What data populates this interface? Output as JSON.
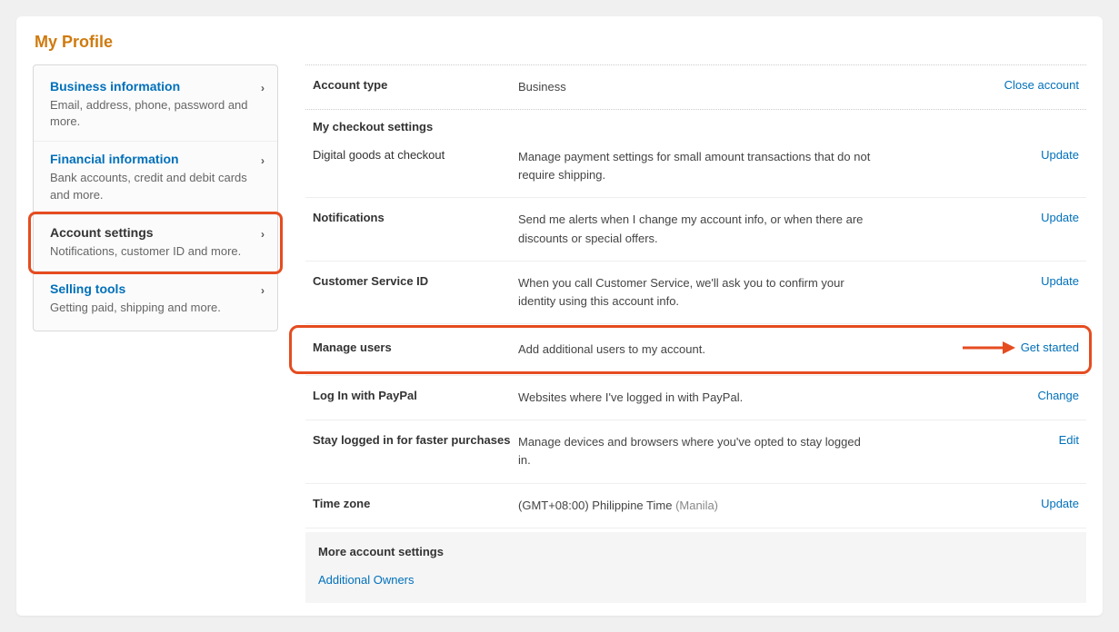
{
  "page_title": "My Profile",
  "sidebar": {
    "items": [
      {
        "title": "Business information",
        "sub": "Email, address, phone, password and more."
      },
      {
        "title": "Financial information",
        "sub": "Bank accounts, credit and debit cards and more."
      },
      {
        "title": "Account settings",
        "sub": "Notifications, customer ID and more."
      },
      {
        "title": "Selling tools",
        "sub": "Getting paid, shipping and more."
      }
    ]
  },
  "main": {
    "account_type_label": "Account type",
    "account_type_value": "Business",
    "close_account_label": "Close account",
    "checkout_header": "My checkout settings",
    "digital_goods_label": "Digital goods at checkout",
    "digital_goods_value": "Manage payment settings for small amount transactions that do not require shipping.",
    "digital_goods_action": "Update",
    "notifications_label": "Notifications",
    "notifications_value": "Send me alerts when I change my account info, or when there are discounts or special offers.",
    "notifications_action": "Update",
    "csid_label": "Customer Service ID",
    "csid_value": "When you call Customer Service, we'll ask you to confirm your identity using this account info.",
    "csid_action": "Update",
    "manage_users_label": "Manage users",
    "manage_users_value": "Add additional users to my account.",
    "manage_users_action": "Get started",
    "login_pp_label": "Log In with PayPal",
    "login_pp_value": "Websites where I've logged in with PayPal.",
    "login_pp_action": "Change",
    "stay_logged_label": "Stay logged in for faster purchases",
    "stay_logged_value": "Manage devices and browsers where you've opted to stay logged in.",
    "stay_logged_action": "Edit",
    "timezone_label": "Time zone",
    "timezone_value": "(GMT+08:00) Philippine Time",
    "timezone_note": "(Manila)",
    "timezone_action": "Update",
    "more_title": "More account settings",
    "more_link": "Additional Owners"
  }
}
